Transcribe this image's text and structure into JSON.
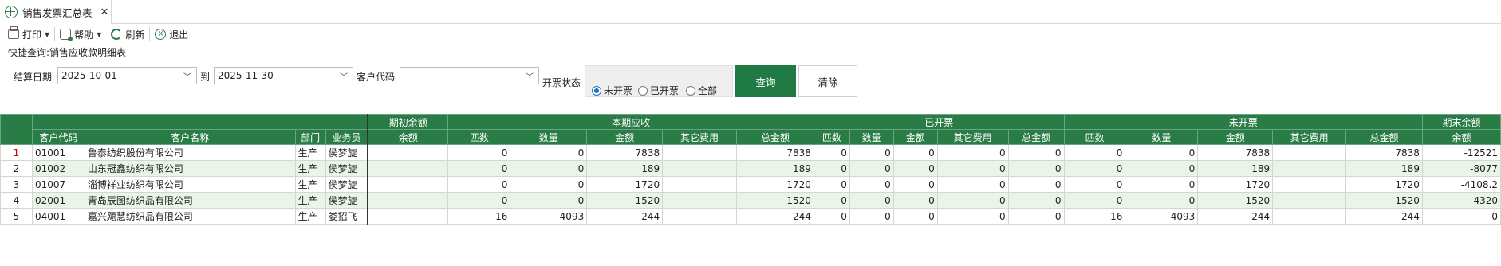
{
  "tab": {
    "title": "销售发票汇总表",
    "close": "✕"
  },
  "toolbar": {
    "print": "打印",
    "help": "帮助",
    "refresh": "刷新",
    "exit": "退出"
  },
  "quick_query": "快捷查询:销售应收款明细表",
  "filter": {
    "settle_date_label": "结算日期",
    "date_from": "2025-10-01",
    "to_label": "到",
    "date_to": "2025-11-30",
    "customer_code_label": "客户代码",
    "customer_code": "",
    "invoice_status_label": "开票状态",
    "options": [
      "未开票",
      "已开票",
      "全部"
    ],
    "selected": "未开票",
    "query_button": "查询",
    "clear_button": "清除"
  },
  "groups": {
    "opening": "期初余额",
    "current": "本期应收",
    "invoiced": "已开票",
    "uninvoiced": "未开票",
    "closing": "期末余额"
  },
  "columns": {
    "code": "客户代码",
    "name": "客户名称",
    "dept": "部门",
    "sales": "业务员",
    "balance": "余额",
    "pieces": "匹数",
    "qty": "数量",
    "amount": "金额",
    "other": "其它费用",
    "total": "总金额"
  },
  "rows": [
    {
      "no": "1",
      "code": "01001",
      "name": "鲁泰纺织股份有限公司",
      "dept": "生产",
      "sales": "侯梦旋",
      "opening": "",
      "c_pieces": "0",
      "c_qty": "0",
      "c_amount": "7838",
      "c_other": "",
      "c_total": "7838",
      "i_pieces": "0",
      "i_qty": "0",
      "i_amount": "0",
      "i_other": "0",
      "i_total": "0",
      "u_pieces": "0",
      "u_qty": "0",
      "u_amount": "7838",
      "u_other": "",
      "u_total": "7838",
      "closing": "-12521"
    },
    {
      "no": "2",
      "code": "01002",
      "name": "山东冠鑫纺织有限公司",
      "dept": "生产",
      "sales": "侯梦旋",
      "opening": "",
      "c_pieces": "0",
      "c_qty": "0",
      "c_amount": "189",
      "c_other": "",
      "c_total": "189",
      "i_pieces": "0",
      "i_qty": "0",
      "i_amount": "0",
      "i_other": "0",
      "i_total": "0",
      "u_pieces": "0",
      "u_qty": "0",
      "u_amount": "189",
      "u_other": "",
      "u_total": "189",
      "closing": "-8077"
    },
    {
      "no": "3",
      "code": "01007",
      "name": "淄博祥业纺织有限公司",
      "dept": "生产",
      "sales": "侯梦旋",
      "opening": "",
      "c_pieces": "0",
      "c_qty": "0",
      "c_amount": "1720",
      "c_other": "",
      "c_total": "1720",
      "i_pieces": "0",
      "i_qty": "0",
      "i_amount": "0",
      "i_other": "0",
      "i_total": "0",
      "u_pieces": "0",
      "u_qty": "0",
      "u_amount": "1720",
      "u_other": "",
      "u_total": "1720",
      "closing": "-4108.2"
    },
    {
      "no": "4",
      "code": "02001",
      "name": "青岛辰图纺织品有限公司",
      "dept": "生产",
      "sales": "侯梦旋",
      "opening": "",
      "c_pieces": "0",
      "c_qty": "0",
      "c_amount": "1520",
      "c_other": "",
      "c_total": "1520",
      "i_pieces": "0",
      "i_qty": "0",
      "i_amount": "0",
      "i_other": "0",
      "i_total": "0",
      "u_pieces": "0",
      "u_qty": "0",
      "u_amount": "1520",
      "u_other": "",
      "u_total": "1520",
      "closing": "-4320"
    },
    {
      "no": "5",
      "code": "04001",
      "name": "嘉兴飓慧纺织品有限公司",
      "dept": "生产",
      "sales": "娄招飞",
      "opening": "",
      "c_pieces": "16",
      "c_qty": "4093",
      "c_amount": "244",
      "c_other": "",
      "c_total": "244",
      "i_pieces": "0",
      "i_qty": "0",
      "i_amount": "0",
      "i_other": "0",
      "i_total": "0",
      "u_pieces": "16",
      "u_qty": "4093",
      "u_amount": "244",
      "u_other": "",
      "u_total": "244",
      "closing": "0"
    }
  ]
}
